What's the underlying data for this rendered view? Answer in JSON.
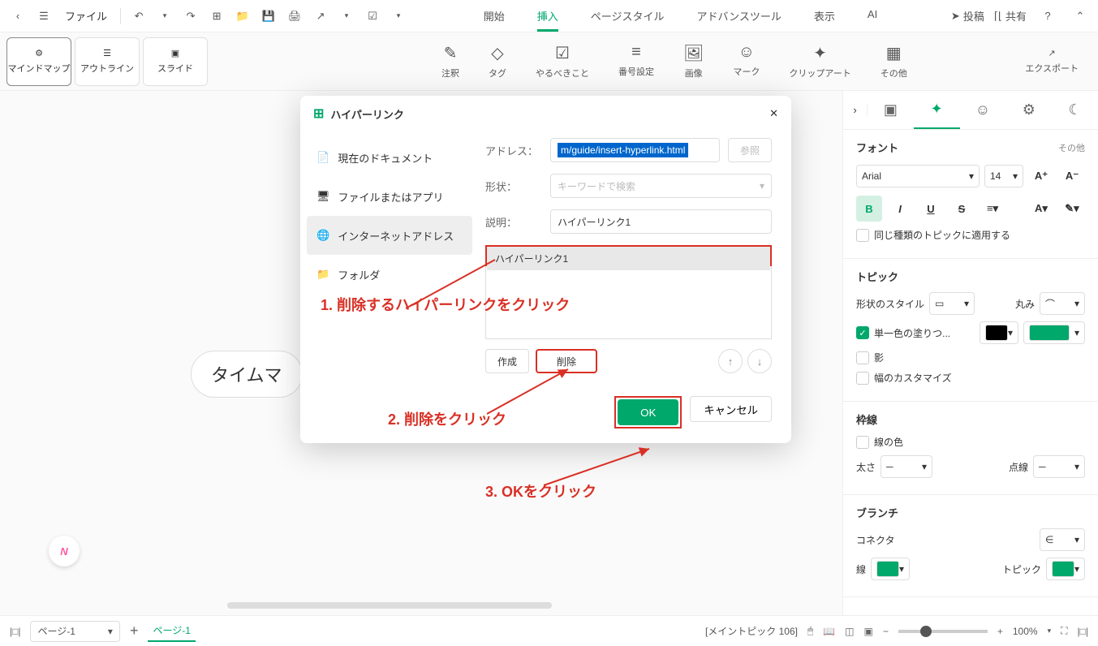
{
  "topbar": {
    "file_menu": "ファイル",
    "tabs": [
      "開始",
      "挿入",
      "ページスタイル",
      "アドバンスツール",
      "表示",
      "AI"
    ],
    "active_tab": 1,
    "post": "投稿",
    "share": "共有"
  },
  "ribbon": {
    "views": {
      "mindmap": "マインドマップ",
      "outline": "アウトライン",
      "slide": "スライド"
    },
    "tools": {
      "comment": "注釈",
      "tag": "タグ",
      "todo": "やるべきこと",
      "numbering": "番号設定",
      "image": "画像",
      "mark": "マーク",
      "clipart": "クリップアート",
      "other": "その他",
      "export": "エクスポート"
    }
  },
  "dialog": {
    "title": "ハイパーリンク",
    "side": {
      "current_doc": "現在のドキュメント",
      "file_app": "ファイルまたはアプリ",
      "internet": "インターネットアドレス",
      "folder": "フォルダ"
    },
    "labels": {
      "address": "アドレス：",
      "shape": "形状：",
      "desc": "説明：",
      "shape_placeholder": "キーワードで検索"
    },
    "address_value": "m/guide/insert-hyperlink.html",
    "desc_value": "ハイパーリンク1",
    "list_item": "ハイパーリンク1",
    "browse": "参照",
    "create": "作成",
    "delete": "削除",
    "ok": "OK",
    "cancel": "キャンセル"
  },
  "annotations": {
    "a1": "1. 削除するハイパーリンクをクリック",
    "a2": "2. 削除をクリック",
    "a3": "3. OKをクリック"
  },
  "canvas": {
    "node_text": "タイムマ"
  },
  "side": {
    "font": {
      "title": "フォント",
      "more": "その他",
      "family": "Arial",
      "size": "14",
      "apply_same": "同じ種類のトピックに適用する"
    },
    "topic": {
      "title": "トピック",
      "shape_style": "形状のスタイル",
      "round": "丸み",
      "solid_fill": "単一色の塗りつ...",
      "shadow": "影",
      "custom_width": "幅のカスタマイズ"
    },
    "border": {
      "title": "枠線",
      "line_color": "線の色",
      "thickness": "太さ",
      "dotted": "点線"
    },
    "branch": {
      "title": "ブランチ",
      "connector": "コネクタ",
      "line": "線",
      "topic": "トピック"
    }
  },
  "status": {
    "page_label": "ページ-1",
    "page_tab": "ページ-1",
    "topic_info": "[メイントピック 106]",
    "zoom": "100%"
  }
}
